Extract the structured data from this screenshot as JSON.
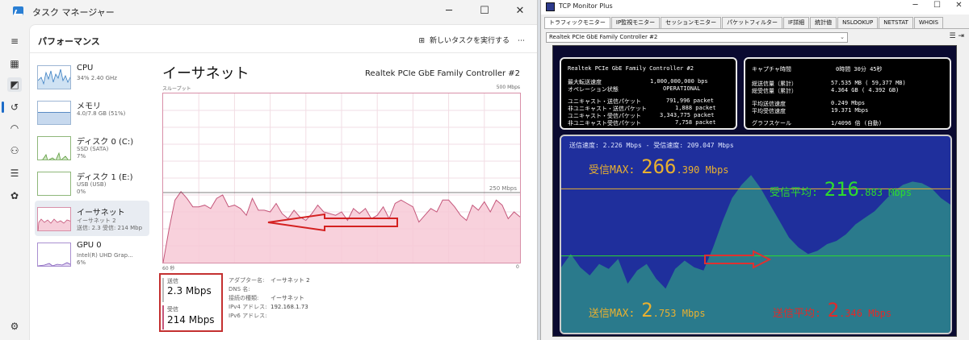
{
  "task_manager": {
    "window_title": "タスク マネージャー",
    "page_title": "パフォーマンス",
    "run_task": "新しいタスクを実行する",
    "heading": "イーサネット",
    "adapter": "Realtek PCIe GbE Family Controller #2",
    "graph_label_left": "スループット",
    "graph_label_right": "500 Mbps",
    "graph_scale_marker": "250 Mbps",
    "time_left": "60 秒",
    "time_right": "0",
    "send_label": "送信",
    "send_value": "2.3 Mbps",
    "recv_label": "受信",
    "recv_value": "214 Mbps",
    "send_history_percent": [
      0,
      20,
      37,
      42,
      38,
      33,
      33,
      34,
      32,
      38,
      40,
      33,
      34,
      32,
      28,
      38,
      31,
      31,
      30,
      35,
      29,
      26,
      31,
      27,
      25,
      29,
      34,
      30,
      29,
      28,
      30,
      25,
      32,
      29,
      32,
      26,
      28,
      33,
      26,
      35,
      37,
      35,
      33,
      24,
      28,
      32,
      30,
      37,
      37,
      33,
      28,
      25,
      34,
      31,
      36,
      30,
      37,
      34,
      26,
      30,
      27
    ],
    "properties": [
      {
        "k": "アダプター名:",
        "v": "イーサネット 2"
      },
      {
        "k": "DNS 名:",
        "v": ""
      },
      {
        "k": "接続の種類:",
        "v": "イーサネット"
      },
      {
        "k": "IPv4 アドレス:",
        "v": "192.168.1.73"
      },
      {
        "k": "IPv6 アドレス:",
        "v": ""
      }
    ],
    "sidebar": [
      {
        "name": "CPU",
        "sub1": "34%  2.40 GHz",
        "sub2": ""
      },
      {
        "name": "メモリ",
        "sub1": "4.0/7.8 GB (51%)",
        "sub2": ""
      },
      {
        "name": "ディスク 0 (C:)",
        "sub1": "SSD (SATA)",
        "sub2": "7%"
      },
      {
        "name": "ディスク 1 (E:)",
        "sub1": "USB (USB)",
        "sub2": "0%"
      },
      {
        "name": "イーサネット",
        "sub1": "イーサネット 2",
        "sub2": "送信: 2.3 受信: 214 Mbp"
      },
      {
        "name": "GPU 0",
        "sub1": "Intel(R) UHD Grap...",
        "sub2": "6%"
      }
    ]
  },
  "tcp_monitor": {
    "window_title": "TCP Monitor Plus",
    "tabs": [
      "トラフィックモニター",
      "IP監視モニター",
      "セッションモニター",
      "パケットフィルター",
      "IF詳細",
      "統計値",
      "NSLOOKUP",
      "NETSTAT",
      "WHOIS"
    ],
    "adapter_select": "Realtek PCIe GbE Family Controller #2",
    "left_box": {
      "title": "Realtek PCIe GbE Family Controller #2",
      "max_speed_label": "最大転送速度",
      "max_speed": "1,000,000,000 bps",
      "op_state_label": "オペレーション状態",
      "op_state": "OPERATIONAL",
      "rows": [
        {
          "k": "ユニキャスト・送信パケット",
          "v": "791,996 packet"
        },
        {
          "k": "非ユニキャスト・送信パケット",
          "v": "1,888 packet"
        },
        {
          "k": "ユニキャスト・受信パケット",
          "v": "3,343,775 packet"
        },
        {
          "k": "非ユニキャスト受信パケット",
          "v": "7,758 packet"
        }
      ]
    },
    "right_box": {
      "capture_label": "キャプチャ時間",
      "capture": "0時間 30分 45秒",
      "rows": [
        {
          "k": "総送信量（累計）",
          "v": "57.535 MB ( 59,377 MB)"
        },
        {
          "k": "総受信量（累計）",
          "v": "4.364 GB (  4.392 GB)"
        },
        {
          "k": "平均送信速度",
          "v": "0.249 Mbps"
        },
        {
          "k": "平均受信速度",
          "v": "19.371 Mbps"
        },
        {
          "k": "グラフスケール",
          "v": "1/4096 倍  (自動)"
        }
      ]
    },
    "graph": {
      "speed_line": "送信速度:  2.226 Mbps  -  受信速度: 209.047 Mbps",
      "recv_max_label": "受信MAX:",
      "recv_max_int": "266",
      "recv_max_dec": ".390 Mbps",
      "recv_avg_label": "受信平均:",
      "recv_avg_int": "216",
      "recv_avg_dec": ".883 Mbps",
      "send_max_label": "送信MAX:",
      "send_max_int": "2",
      "send_max_dec": ".753 Mbps",
      "send_avg_label": "送信平均:",
      "send_avg_int": "2",
      "send_avg_dec": ".346 Mbps",
      "recv_history": [
        210,
        218,
        210,
        205,
        212,
        209,
        215,
        200,
        208,
        212,
        203,
        197,
        209,
        214,
        210,
        208,
        222,
        238,
        252,
        260,
        266,
        258,
        248,
        238,
        228,
        222,
        218,
        220,
        224,
        226,
        230,
        236,
        240,
        244,
        250,
        256,
        260,
        262,
        261,
        258,
        252,
        248
      ]
    },
    "colors": {
      "panel_bg": "#0a0a30",
      "graph_bg": "#1f2f9c",
      "fill": "#2a7a8c",
      "recv_avg": "#2ddc2d",
      "max_color": "#e8b030",
      "send_avg": "#e02a2a"
    }
  }
}
